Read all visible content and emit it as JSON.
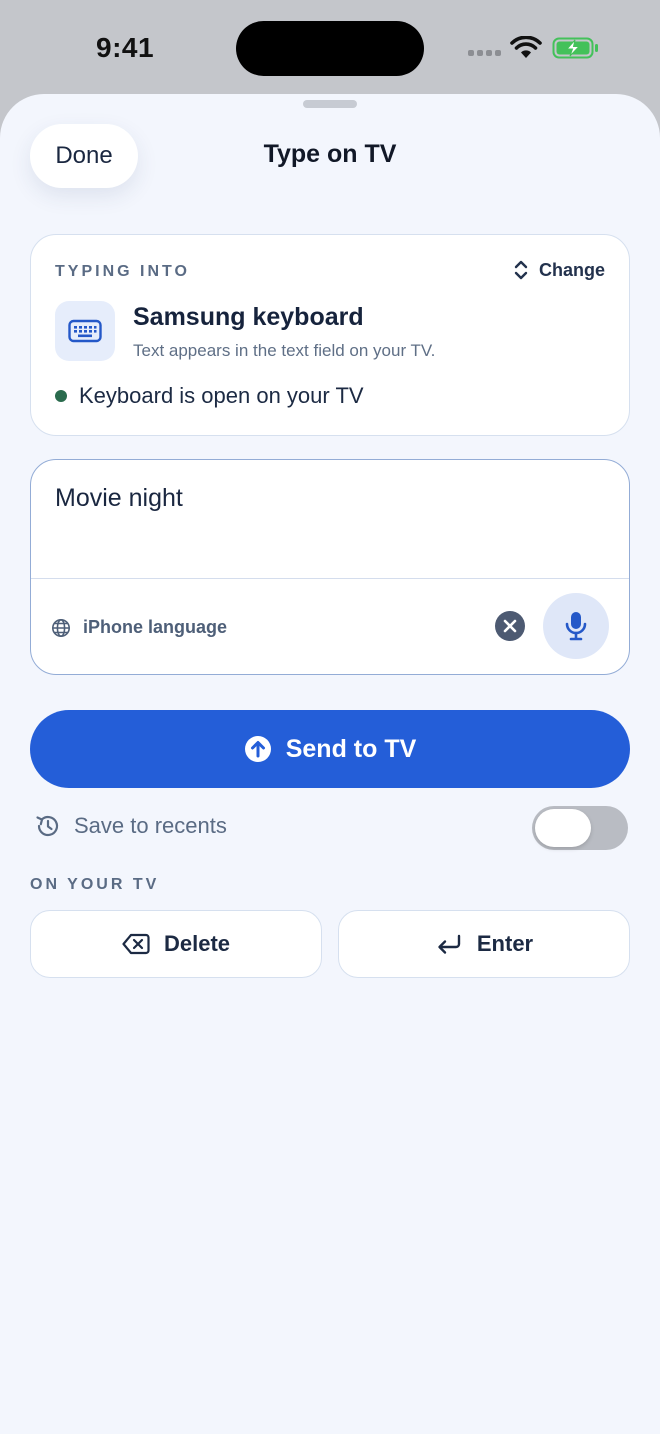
{
  "status_bar": {
    "time": "9:41"
  },
  "header": {
    "done_label": "Done",
    "title": "Type on TV"
  },
  "target": {
    "section_label": "TYPING INTO",
    "change_label": "Change",
    "device_name": "Samsung keyboard",
    "device_description": "Text appears in the text field on your TV.",
    "status_text": "Keyboard is open on your TV",
    "status_color": "#2a6b4d"
  },
  "input": {
    "value": "Movie night",
    "language_label": "iPhone language"
  },
  "send": {
    "label": "Send to TV",
    "color": "#245ed8"
  },
  "recents": {
    "label": "Save to recents",
    "enabled": false
  },
  "tv_actions": {
    "section_label": "ON YOUR TV",
    "delete_label": "Delete",
    "enter_label": "Enter"
  },
  "icons": {
    "keyboard": "keyboard-icon",
    "change": "chevron-up-down-icon",
    "language": "globe-icon",
    "clear": "close-icon",
    "mic": "microphone-icon",
    "send": "arrow-up-circle-icon",
    "recents": "history-icon",
    "delete": "backspace-icon",
    "enter": "return-icon"
  }
}
